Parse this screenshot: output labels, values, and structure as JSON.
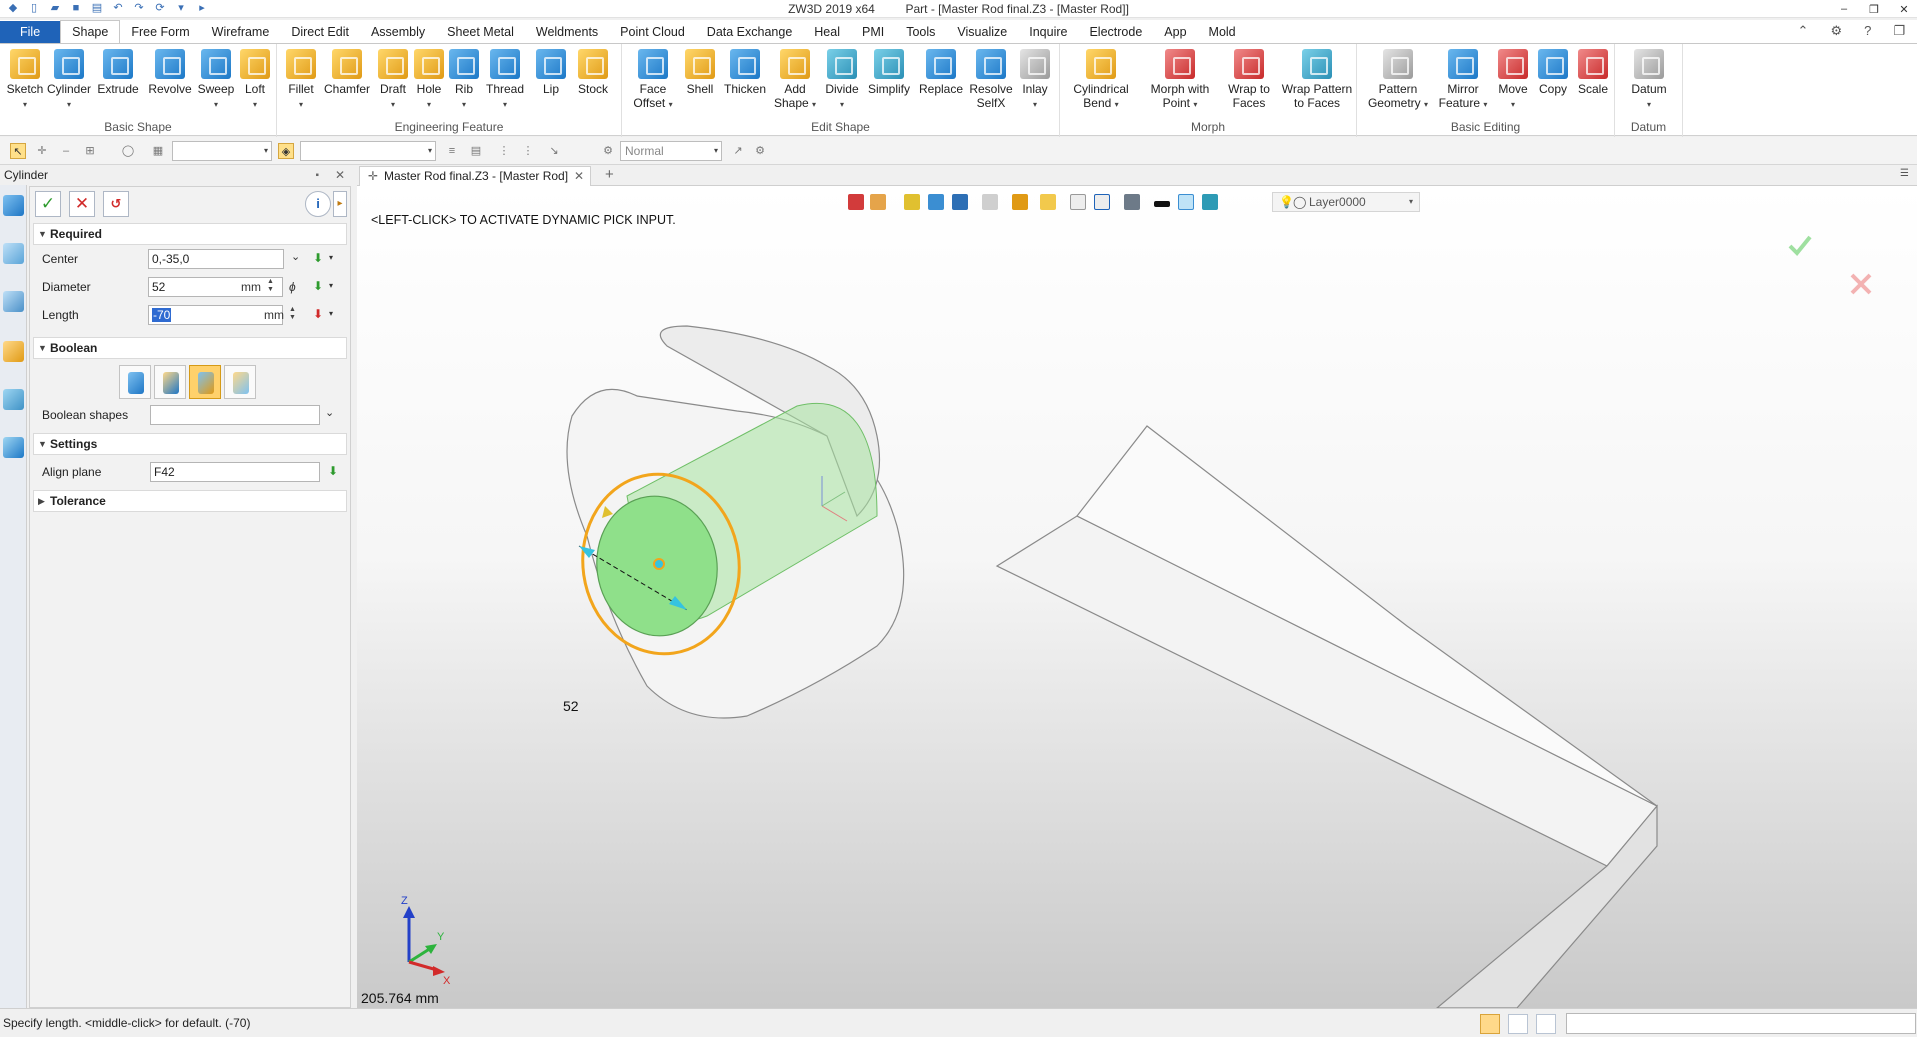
{
  "window": {
    "app_title": "ZW3D 2019  x64",
    "doc_title": "Part - [Master Rod final.Z3 - [Master Rod]]"
  },
  "menu": {
    "tabs": [
      "File",
      "Shape",
      "Free Form",
      "Wireframe",
      "Direct Edit",
      "Assembly",
      "Sheet Metal",
      "Weldments",
      "Point Cloud",
      "Data Exchange",
      "Heal",
      "PMI",
      "Tools",
      "Visualize",
      "Inquire",
      "Electrode",
      "App",
      "Mold"
    ],
    "active": "Shape"
  },
  "ribbon": {
    "groups": [
      {
        "label": "Basic Shape",
        "buttons": [
          "Sketch",
          "Cylinder",
          "Extrude",
          "Revolve",
          "Sweep",
          "Loft"
        ]
      },
      {
        "label": "Engineering Feature",
        "buttons": [
          "Fillet",
          "Chamfer",
          "Draft",
          "Hole",
          "Rib",
          "Thread",
          "Lip",
          "Stock"
        ]
      },
      {
        "label": "Edit Shape",
        "buttons": [
          "Face Offset",
          "Shell",
          "Thicken",
          "Add Shape",
          "Divide",
          "Simplify",
          "Replace",
          "Resolve SelfX",
          "Inlay"
        ]
      },
      {
        "label": "Morph",
        "buttons": [
          "Cylindrical Bend",
          "Morph with Point",
          "Wrap to Faces",
          "Wrap Pattern to Faces"
        ]
      },
      {
        "label": "Basic Editing",
        "buttons": [
          "Pattern Geometry",
          "Mirror Feature",
          "Move",
          "Copy",
          "Scale"
        ]
      },
      {
        "label": "Datum",
        "buttons": [
          "Datum"
        ]
      }
    ]
  },
  "toolbar": {
    "render_mode": "Normal"
  },
  "panel": {
    "title": "Cylinder",
    "sections": {
      "required": "Required",
      "boolean": "Boolean",
      "settings": "Settings",
      "tolerance": "Tolerance"
    },
    "fields": {
      "center_label": "Center",
      "center_value": "0,-35,0",
      "diameter_label": "Diameter",
      "diameter_value": "52",
      "diameter_unit": "mm",
      "length_label": "Length",
      "length_value": "-70",
      "length_unit": "mm",
      "boolean_shapes_label": "Boolean shapes",
      "boolean_shapes_value": "",
      "align_plane_label": "Align plane",
      "align_plane_value": "F42"
    },
    "diameter_symbol": "ϕ"
  },
  "document": {
    "tab_label": "Master Rod final.Z3 - [Master Rod]"
  },
  "viewport": {
    "prompt": "<LEFT-CLICK> TO ACTIVATE DYNAMIC PICK INPUT.",
    "measure": "205.764 mm",
    "dimension_label": "52",
    "layer": "Layer0000",
    "triad": {
      "x": "X",
      "y": "Y",
      "z": "Z"
    }
  },
  "status": {
    "text": "Specify length.  <middle-click> for default. (-70)"
  },
  "colors": {
    "accent": "#1f63b8",
    "preview_green": "#8fe08a",
    "highlight_orange": "#f2a51c"
  }
}
